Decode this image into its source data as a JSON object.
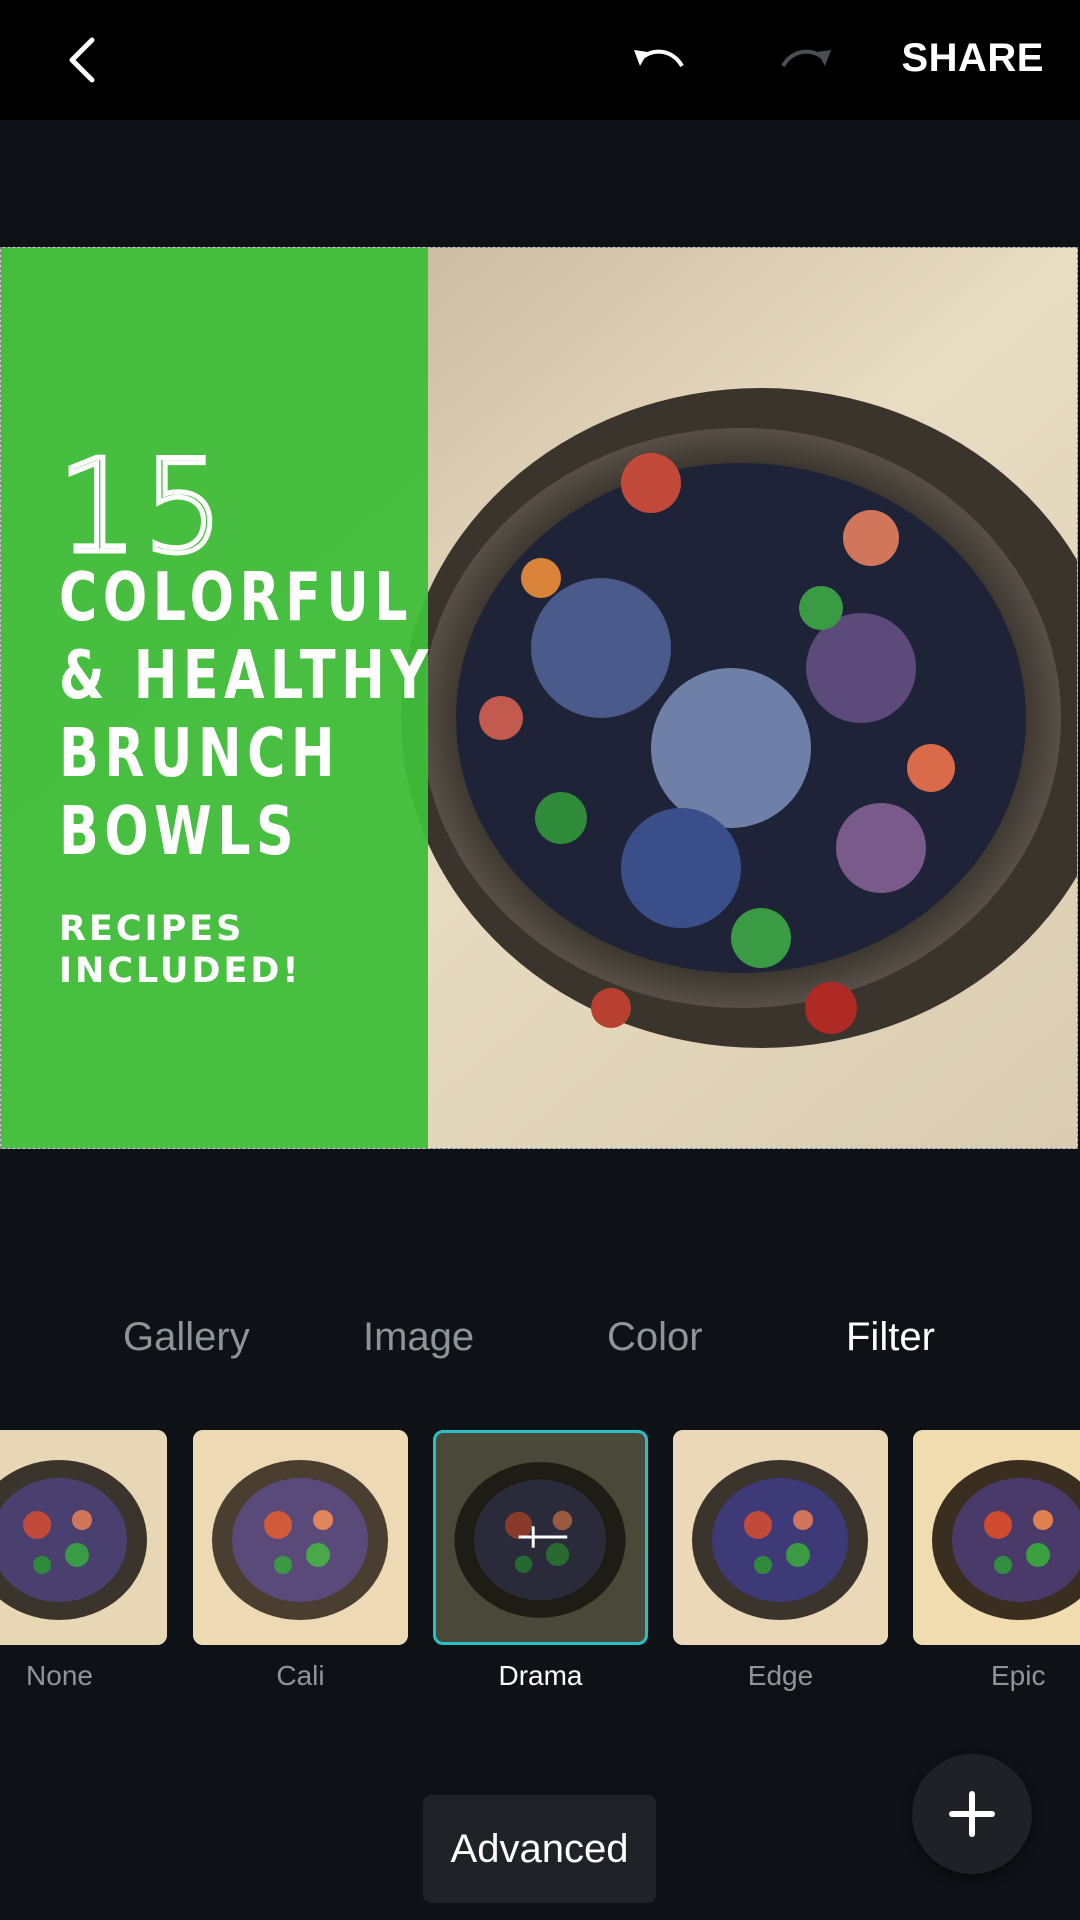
{
  "header": {
    "share_label": "SHARE"
  },
  "design": {
    "title_number": "15",
    "title_lines": [
      "COLORFUL",
      "& HEALTHY",
      "BRUNCH",
      "BOWLS"
    ],
    "subtitle_lines": [
      "RECIPES",
      "INCLUDED!"
    ],
    "accent_color": "#3fbe3a"
  },
  "tabs": [
    {
      "label": "Gallery"
    },
    {
      "label": "Image"
    },
    {
      "label": "Color"
    },
    {
      "label": "Filter"
    }
  ],
  "active_tab": "Filter",
  "filters": [
    {
      "label": "None"
    },
    {
      "label": "Cali"
    },
    {
      "label": "Drama"
    },
    {
      "label": "Edge"
    },
    {
      "label": "Epic"
    }
  ],
  "selected_filter": "Drama",
  "advanced_label": "Advanced",
  "selection_color": "#25c0c4"
}
